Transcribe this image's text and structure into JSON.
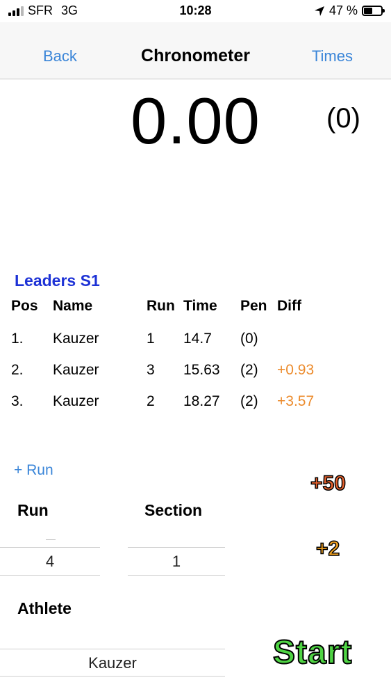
{
  "status_bar": {
    "carrier": "SFR",
    "network": "3G",
    "time": "10:28",
    "battery": "47 %",
    "battery_level": 0.47
  },
  "nav": {
    "back": "Back",
    "title": "Chronometer",
    "times": "Times"
  },
  "timer": {
    "value": "0.00",
    "penalty": "(0)"
  },
  "leaders": {
    "title": "Leaders S1",
    "headers": [
      "Pos",
      "Name",
      "Run",
      "Time",
      "Pen",
      "Diff"
    ],
    "rows": [
      {
        "pos": "1.",
        "name": "Kauzer",
        "run": "1",
        "time": "14.7",
        "pen": "(0)",
        "diff": ""
      },
      {
        "pos": "2.",
        "name": "Kauzer",
        "run": "3",
        "time": "15.63",
        "pen": "(2)",
        "diff": "+0.93"
      },
      {
        "pos": "3.",
        "name": "Kauzer",
        "run": "2",
        "time": "18.27",
        "pen": "(2)",
        "diff": "+3.57"
      }
    ]
  },
  "add_run": "+ Run",
  "penalties": {
    "plus50": "+50",
    "plus2": "+2"
  },
  "run_picker": {
    "label": "Run",
    "value": "4"
  },
  "section_picker": {
    "label": "Section",
    "value": "1"
  },
  "athlete_picker": {
    "label": "Athlete",
    "value": "Kauzer"
  },
  "start": "Start",
  "colors": {
    "link": "#3a85d8",
    "leaders_title": "#1d32d6",
    "diff": "#ec8b2c",
    "start": "#4fd444",
    "plus50": "#e8622e",
    "plus2": "#f0a020"
  }
}
